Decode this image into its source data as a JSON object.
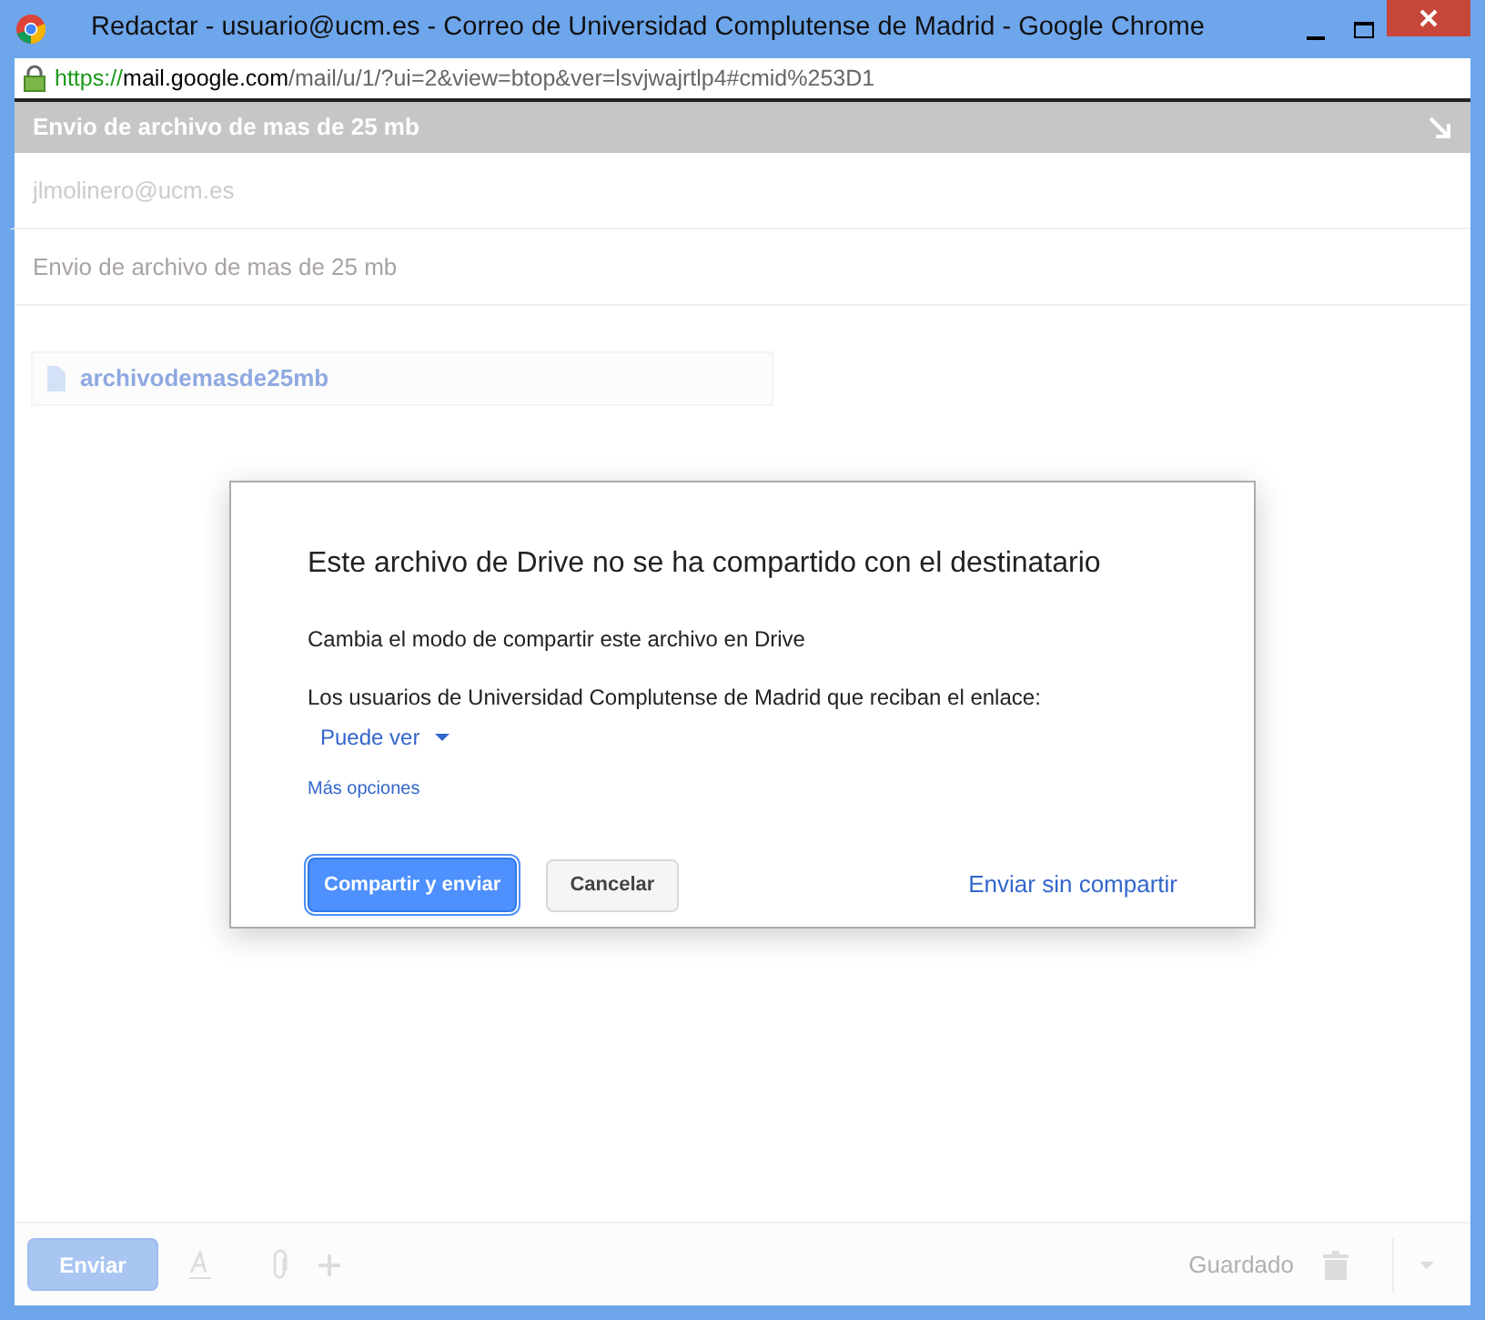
{
  "window": {
    "title": "Redactar - usuario@ucm.es - Correo de Universidad Complutense de Madrid - Google Chrome"
  },
  "address_bar": {
    "scheme": "https://",
    "host": "mail.google.com",
    "path": "/mail/u/1/?ui=2&view=btop&ver=lsvjwajrtlp4#cmid%253D1"
  },
  "compose": {
    "header": "Envio de archivo de mas de 25 mb",
    "to": "jlmolinero@ucm.es",
    "subject": "Envio de archivo de mas de 25 mb",
    "attachment": "archivodemasde25mb"
  },
  "dialog": {
    "title": "Este archivo de Drive no se ha compartido con el destinatario",
    "subtitle": "Cambia el modo de compartir este archivo en Drive",
    "audience": "Los usuarios de Universidad Complutense de Madrid que reciban el enlace:",
    "permission": "Puede ver",
    "more_options": "Más opciones",
    "buttons": [
      {
        "label": "Compartir y enviar",
        "kind": "primary"
      },
      {
        "label": "Cancelar",
        "kind": "secondary"
      },
      {
        "label": "Enviar sin compartir",
        "kind": "link"
      }
    ]
  },
  "footer": {
    "send": "Enviar",
    "saved": "Guardado"
  }
}
